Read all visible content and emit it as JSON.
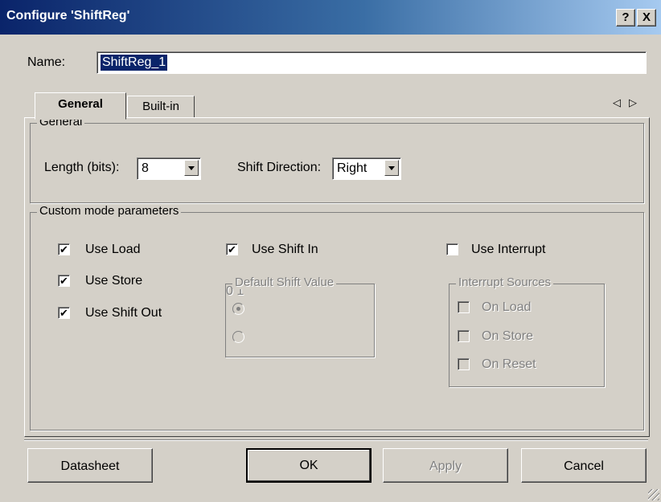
{
  "window": {
    "title": "Configure 'ShiftReg'",
    "help_btn": "?",
    "close_btn": "X"
  },
  "name": {
    "label": "Name:",
    "value": "ShiftReg_1"
  },
  "tabs": [
    {
      "label": "General"
    },
    {
      "label": "Built-in"
    }
  ],
  "tab_scroll": {
    "left": "◁",
    "right": "▷"
  },
  "general_group": {
    "legend": "General",
    "length_label": "Length (bits):",
    "length_value": "8",
    "direction_label": "Shift Direction:",
    "direction_value": "Right"
  },
  "custom_group": {
    "legend": "Custom mode parameters",
    "use_load": {
      "label": "Use Load",
      "checked": true
    },
    "use_store": {
      "label": "Use Store",
      "checked": true
    },
    "use_shift_out": {
      "label": "Use Shift Out",
      "checked": true
    },
    "use_shift_in": {
      "label": "Use Shift In",
      "checked": true
    },
    "use_interrupt": {
      "label": "Use Interrupt",
      "checked": false
    },
    "default_shift": {
      "legend": "Default Shift Value",
      "options": [
        {
          "label": "0",
          "selected": true
        },
        {
          "label": "1",
          "selected": false
        }
      ]
    },
    "interrupt_sources": {
      "legend": "Interrupt Sources",
      "items": [
        {
          "label": "On Load"
        },
        {
          "label": "On Store"
        },
        {
          "label": "On Reset"
        }
      ]
    }
  },
  "buttons": {
    "datasheet": "Datasheet",
    "ok": "OK",
    "apply": "Apply",
    "cancel": "Cancel"
  },
  "checkmark": "✔"
}
